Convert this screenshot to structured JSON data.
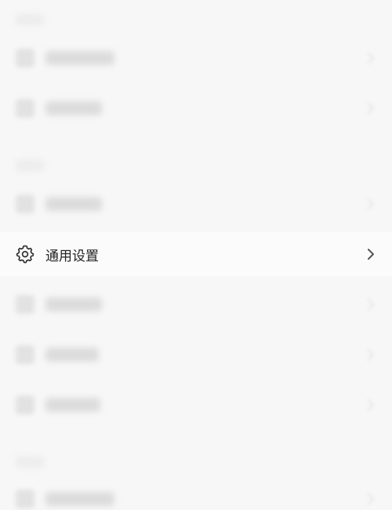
{
  "settings": {
    "visible_item": {
      "label": "通用设置",
      "icon": "gear-icon",
      "chevron": "chevron-right-icon"
    }
  },
  "colors": {
    "background": "#f7f7f7",
    "text": "#222222",
    "icon": "#333333",
    "chevron": "#555555"
  }
}
